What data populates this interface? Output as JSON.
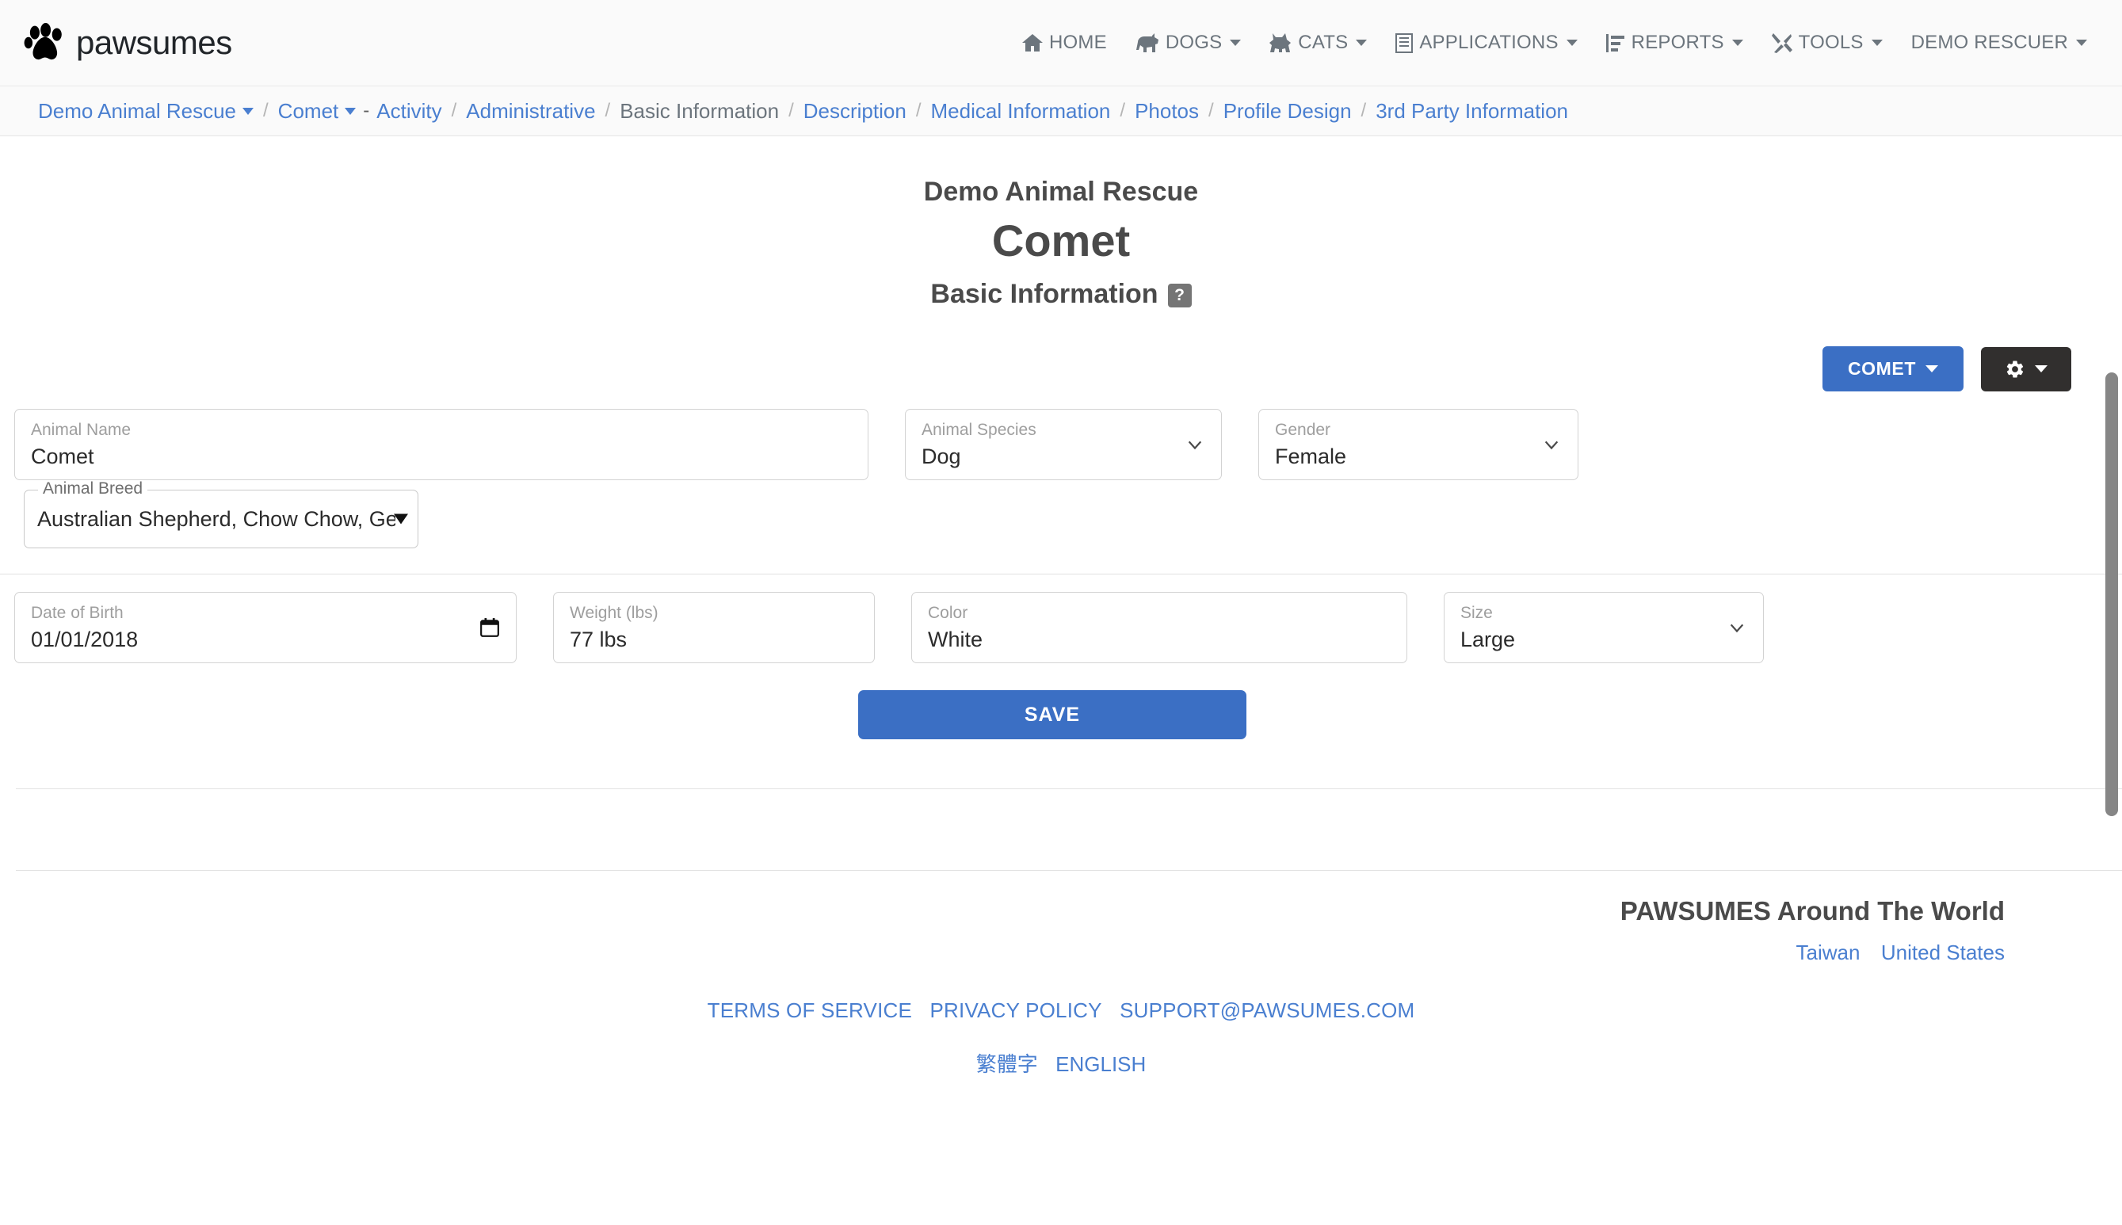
{
  "brand": {
    "name": "pawsumes",
    "logo_icon": "paw-print-icon"
  },
  "nav": {
    "items": [
      {
        "label": "HOME",
        "icon": "home-icon",
        "has_caret": false
      },
      {
        "label": "DOGS",
        "icon": "dog-icon",
        "has_caret": true
      },
      {
        "label": "CATS",
        "icon": "cat-icon",
        "has_caret": true
      },
      {
        "label": "APPLICATIONS",
        "icon": "document-list-icon",
        "has_caret": true
      },
      {
        "label": "REPORTS",
        "icon": "bar-chart-icon",
        "has_caret": true
      },
      {
        "label": "TOOLS",
        "icon": "tools-icon",
        "has_caret": true
      },
      {
        "label": "DEMO RESCUER",
        "icon": "",
        "has_caret": true
      }
    ]
  },
  "breadcrumb": {
    "org": "Demo Animal Rescue",
    "animal": "Comet",
    "dash": "-",
    "items": [
      {
        "label": "Activity",
        "current": false
      },
      {
        "label": "Administrative",
        "current": false
      },
      {
        "label": "Basic Information",
        "current": true
      },
      {
        "label": "Description",
        "current": false
      },
      {
        "label": "Medical Information",
        "current": false
      },
      {
        "label": "Photos",
        "current": false
      },
      {
        "label": "Profile Design",
        "current": false
      },
      {
        "label": "3rd Party Information",
        "current": false
      }
    ],
    "separator": "/"
  },
  "header": {
    "org": "Demo Animal Rescue",
    "animal": "Comet",
    "section": "Basic Information",
    "help_badge": "?"
  },
  "actions": {
    "animal_menu_label": "COMET",
    "settings_icon": "gear-icon"
  },
  "form": {
    "animal_name": {
      "label": "Animal Name",
      "value": "Comet"
    },
    "animal_species": {
      "label": "Animal Species",
      "value": "Dog"
    },
    "gender": {
      "label": "Gender",
      "value": "Female"
    },
    "animal_breed": {
      "label": "Animal Breed",
      "value": "Australian Shepherd, Chow Chow, German Shepherd Dog, Great"
    },
    "date_of_birth": {
      "label": "Date of Birth",
      "value": "01/01/2018"
    },
    "weight": {
      "label": "Weight (lbs)",
      "value": "77 lbs"
    },
    "color": {
      "label": "Color",
      "value": "White"
    },
    "size": {
      "label": "Size",
      "value": "Large"
    },
    "save_label": "SAVE"
  },
  "footer": {
    "world_title": "PAWSUMES Around The World",
    "countries": [
      {
        "label": "Taiwan"
      },
      {
        "label": "United States"
      }
    ],
    "links": [
      {
        "label": "TERMS OF SERVICE"
      },
      {
        "label": "PRIVACY POLICY"
      },
      {
        "label": "SUPPORT@PAWSUMES.COM"
      }
    ],
    "languages": [
      {
        "label": "繁體字"
      },
      {
        "label": "ENGLISH"
      }
    ]
  },
  "colors": {
    "primary": "#3b6fc4",
    "link": "#4a7fd0",
    "dark": "#312f2e",
    "muted": "#6c757d"
  }
}
